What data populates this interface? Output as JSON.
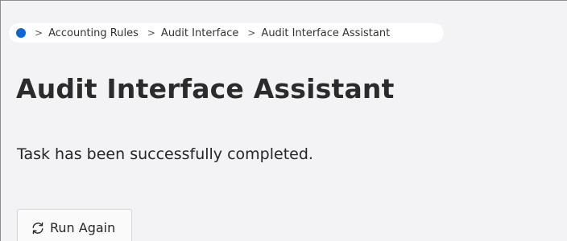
{
  "breadcrumb": {
    "items": [
      "Accounting Rules",
      "Audit Interface",
      "Audit Interface Assistant"
    ],
    "separator": ">"
  },
  "page": {
    "title": "Audit Interface Assistant",
    "message": "Task has been successfully completed."
  },
  "actions": {
    "run_again_label": "Run Again",
    "run_again_icon": "refresh-icon"
  },
  "colors": {
    "background": "#f3f2f5",
    "home_dot": "#0f66d0"
  }
}
